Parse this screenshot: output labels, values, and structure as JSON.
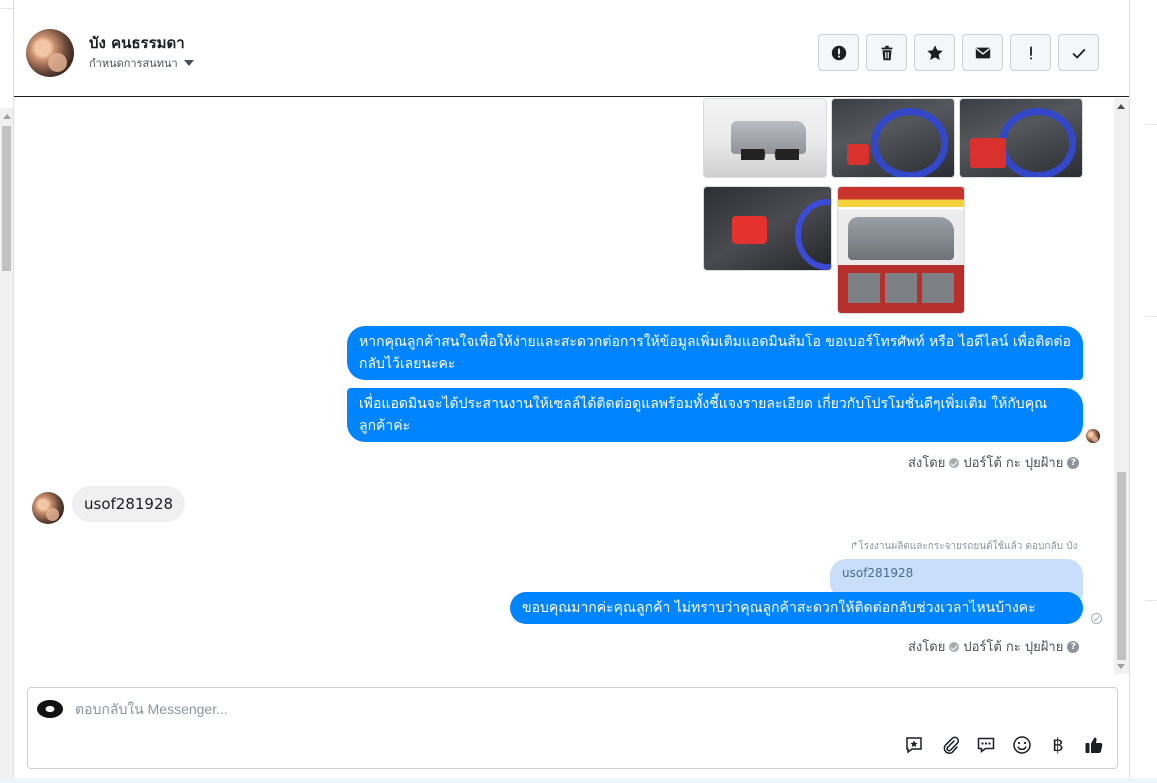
{
  "header": {
    "name": "บัง คนธรรมดา",
    "subtitle": "กำหนดการสนทนา",
    "toolbar": [
      {
        "icon": "alert-circle-icon",
        "glyph": "!"
      },
      {
        "icon": "trash-icon"
      },
      {
        "icon": "star-icon"
      },
      {
        "icon": "envelope-icon"
      },
      {
        "icon": "exclamation-icon",
        "glyph": "!"
      },
      {
        "icon": "check-icon"
      }
    ]
  },
  "thread": {
    "photos": [
      "truck-rear",
      "steering-wheel",
      "steering-wheel-red",
      "gear-shift",
      "promo-poster"
    ],
    "messages_out_1": [
      "หากคุณลูกค้าสนใจเพื่อให้ง่ายและสะดวกต่อการให้ข้อมูลเพิ่มเติมแอดมินส้มโอ ขอเบอร์โทรศัพท์ หรือ ไอดีไลน์ เพื่อติดต่อกลับไว้เลยนะคะ",
      "เพื่อแอดมินจะได้ประสานงานให้เซลล์ได้ติดต่อดูแลพร้อมทั้งชี้แจงรายละเอียด เกี่ยวกับโปรโมชั่นดีๆเพิ่มเติม ให้กับคุณลูกค้าค่ะ"
    ],
    "sent_by_1": {
      "prefix": "ส่งโดย",
      "agent": "ปอร์โต้ กะ ปุยฝ้าย"
    },
    "incoming": "usof281928",
    "reply_note": "โรงงานผลิตและกระจายรถยนต์ใช้แล้ว ตอบกลับ บัง",
    "quoted": "usof281928",
    "messages_out_2": "ขอบคุณมากค่ะคุณลูกค้า ไม่ทราบว่าคุณลูกค้าสะดวกให้ติดต่อกลับช่วงเวลาไหนบ้างคะ",
    "sent_by_2": {
      "prefix": "ส่งโดย",
      "agent": "ปอร์โต้ กะ ปุยฝ้าย"
    }
  },
  "composer": {
    "placeholder": "ตอบกลับใน Messenger...",
    "actions": [
      "saved-reply-icon",
      "attachment-icon",
      "chat-icon",
      "emoji-icon",
      "baht-icon",
      "like-icon"
    ],
    "baht": "฿"
  }
}
